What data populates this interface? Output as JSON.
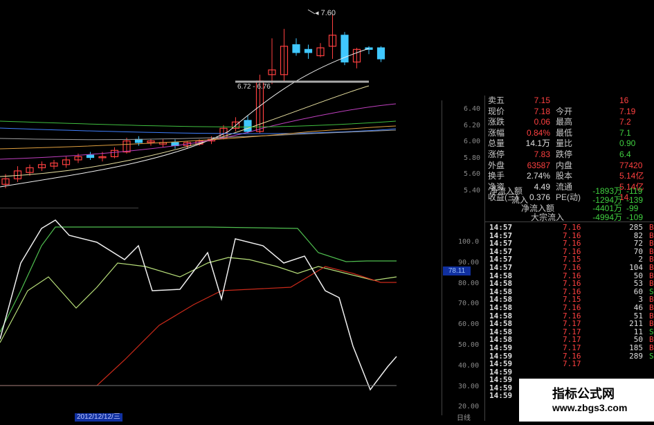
{
  "colors": {
    "up": "#ff4040",
    "down": "#40c8ff",
    "bg": "#000000",
    "k_line": "#f0f0f0",
    "d_line": "#b8e07a",
    "j_line": "#50c050",
    "slow_line": "#cc2a1a"
  },
  "price_axis": [
    "6.40",
    "6.20",
    "6.00",
    "5.80",
    "5.60",
    "5.40"
  ],
  "kdj_axis": [
    "100.0",
    "90.00",
    "80.00",
    "70.00",
    "60.00",
    "50.00",
    "40.00",
    "30.00",
    "20.00"
  ],
  "kdj_current": "78.11",
  "target_label": "7.60",
  "range_label": "6.72 - 6.76",
  "date_label": "2012/12/12/三",
  "period_label": "日线",
  "watermark": {
    "line1": "指标公式网",
    "line2": "www.zbgs3.com"
  },
  "quote": {
    "rows": [
      {
        "l1": "卖五",
        "v1": "7.15",
        "l2": "",
        "v2": "16"
      },
      {
        "l1": "现价",
        "v1": "7.18",
        "l2": "今开",
        "v2": "7.19"
      },
      {
        "l1": "涨跌",
        "v1": "0.06",
        "l2": "最高",
        "v2": "7.2"
      },
      {
        "l1": "涨幅",
        "v1": "0.84%",
        "l2": "最低",
        "v2": "7.1"
      },
      {
        "l1": "总量",
        "v1": "14.1万",
        "l2": "量比",
        "v2": "0.90"
      },
      {
        "l1": "涨停",
        "v1": "7.83",
        "l2": "跌停",
        "v2": "6.4"
      },
      {
        "l1": "外盘",
        "v1": "63587",
        "l2": "内盘",
        "v2": "77420"
      },
      {
        "l1": "换手",
        "v1": "2.74%",
        "l2": "股本",
        "v2": "5.14亿"
      },
      {
        "l1": "净资",
        "v1": "4.49",
        "l2": "流通",
        "v2": "5.14亿"
      },
      {
        "l1": "收益(三)",
        "v1": "0.376",
        "l2": "PE(动)",
        "v2": "14."
      }
    ]
  },
  "flow": [
    {
      "label": "净流入额",
      "v1": "-1893万",
      "v2": "-119"
    },
    {
      "label": "流入",
      "v1": "-1294万",
      "v2": "-139"
    },
    {
      "label": "净流入额",
      "v1": "-4401万",
      "v2": "-99"
    },
    {
      "label": "大宗流入",
      "v1": "-4994万",
      "v2": "-109"
    }
  ],
  "ticks": [
    {
      "t": "14:57",
      "p": "7.16",
      "v": "285",
      "f": "B"
    },
    {
      "t": "14:57",
      "p": "7.16",
      "v": "82",
      "f": "B"
    },
    {
      "t": "14:57",
      "p": "7.16",
      "v": "72",
      "f": "B"
    },
    {
      "t": "14:57",
      "p": "7.16",
      "v": "70",
      "f": "B"
    },
    {
      "t": "14:57",
      "p": "7.15",
      "v": "2",
      "f": "B"
    },
    {
      "t": "14:57",
      "p": "7.16",
      "v": "104",
      "f": "B"
    },
    {
      "t": "14:58",
      "p": "7.16",
      "v": "50",
      "f": "B"
    },
    {
      "t": "14:58",
      "p": "7.16",
      "v": "53",
      "f": "B"
    },
    {
      "t": "14:58",
      "p": "7.16",
      "v": "60",
      "f": "S"
    },
    {
      "t": "14:58",
      "p": "7.15",
      "v": "3",
      "f": "B"
    },
    {
      "t": "14:58",
      "p": "7.16",
      "v": "46",
      "f": "B"
    },
    {
      "t": "14:58",
      "p": "7.16",
      "v": "51",
      "f": "B"
    },
    {
      "t": "14:58",
      "p": "7.17",
      "v": "211",
      "f": "B"
    },
    {
      "t": "14:58",
      "p": "7.17",
      "v": "11",
      "f": "S"
    },
    {
      "t": "14:58",
      "p": "7.17",
      "v": "50",
      "f": "B"
    },
    {
      "t": "14:59",
      "p": "7.17",
      "v": "185",
      "f": "B"
    },
    {
      "t": "14:59",
      "p": "7.16",
      "v": "289",
      "f": "S"
    },
    {
      "t": "14:59",
      "p": "7.17",
      "v": "",
      "f": ""
    },
    {
      "t": "14:59",
      "p": "",
      "v": "",
      "f": ""
    },
    {
      "t": "14:59",
      "p": "",
      "v": "",
      "f": ""
    },
    {
      "t": "14:59",
      "p": "",
      "v": "",
      "f": ""
    },
    {
      "t": "14:59",
      "p": "",
      "v": "",
      "f": ""
    }
  ],
  "candles": [
    {
      "o": 5.45,
      "h": 5.58,
      "l": 5.4,
      "c": 5.52
    },
    {
      "o": 5.52,
      "h": 5.68,
      "l": 5.48,
      "c": 5.62
    },
    {
      "o": 5.6,
      "h": 5.7,
      "l": 5.56,
      "c": 5.66
    },
    {
      "o": 5.66,
      "h": 5.74,
      "l": 5.62,
      "c": 5.7
    },
    {
      "o": 5.68,
      "h": 5.76,
      "l": 5.64,
      "c": 5.72
    },
    {
      "o": 5.7,
      "h": 5.8,
      "l": 5.66,
      "c": 5.76
    },
    {
      "o": 5.76,
      "h": 5.84,
      "l": 5.72,
      "c": 5.8
    },
    {
      "o": 5.82,
      "h": 5.86,
      "l": 5.76,
      "c": 5.79
    },
    {
      "o": 5.79,
      "h": 5.86,
      "l": 5.74,
      "c": 5.8
    },
    {
      "o": 5.8,
      "h": 5.92,
      "l": 5.78,
      "c": 5.88
    },
    {
      "o": 5.86,
      "h": 6.04,
      "l": 5.84,
      "c": 6.0
    },
    {
      "o": 6.02,
      "h": 6.06,
      "l": 5.94,
      "c": 5.98
    },
    {
      "o": 5.98,
      "h": 6.02,
      "l": 5.94,
      "c": 6.0
    },
    {
      "o": 5.96,
      "h": 6.02,
      "l": 5.92,
      "c": 5.98
    },
    {
      "o": 5.98,
      "h": 6.02,
      "l": 5.9,
      "c": 5.94
    },
    {
      "o": 5.94,
      "h": 6.0,
      "l": 5.9,
      "c": 5.98
    },
    {
      "o": 5.96,
      "h": 6.02,
      "l": 5.94,
      "c": 6.0
    },
    {
      "o": 6.0,
      "h": 6.06,
      "l": 5.96,
      "c": 6.02
    },
    {
      "o": 6.04,
      "h": 6.2,
      "l": 6.02,
      "c": 6.16
    },
    {
      "o": 6.16,
      "h": 6.3,
      "l": 6.12,
      "c": 6.24
    },
    {
      "o": 6.26,
      "h": 6.32,
      "l": 6.1,
      "c": 6.12
    },
    {
      "o": 6.12,
      "h": 6.84,
      "l": 6.1,
      "c": 6.76
    },
    {
      "o": 6.84,
      "h": 7.3,
      "l": 6.72,
      "c": 6.9
    },
    {
      "o": 6.84,
      "h": 7.42,
      "l": 6.76,
      "c": 7.2
    },
    {
      "o": 7.22,
      "h": 7.3,
      "l": 7.08,
      "c": 7.12
    },
    {
      "o": 7.16,
      "h": 7.22,
      "l": 7.04,
      "c": 7.12
    },
    {
      "o": 7.08,
      "h": 7.24,
      "l": 7.06,
      "c": 7.18
    },
    {
      "o": 7.2,
      "h": 7.6,
      "l": 7.04,
      "c": 7.34
    },
    {
      "o": 7.34,
      "h": 7.38,
      "l": 6.96,
      "c": 7.0
    },
    {
      "o": 7.0,
      "h": 7.18,
      "l": 6.92,
      "c": 7.16
    },
    {
      "o": 7.18,
      "h": 7.2,
      "l": 7.1,
      "c": 7.16
    },
    {
      "o": 7.18,
      "h": 7.2,
      "l": 7.0,
      "c": 7.04
    }
  ]
}
